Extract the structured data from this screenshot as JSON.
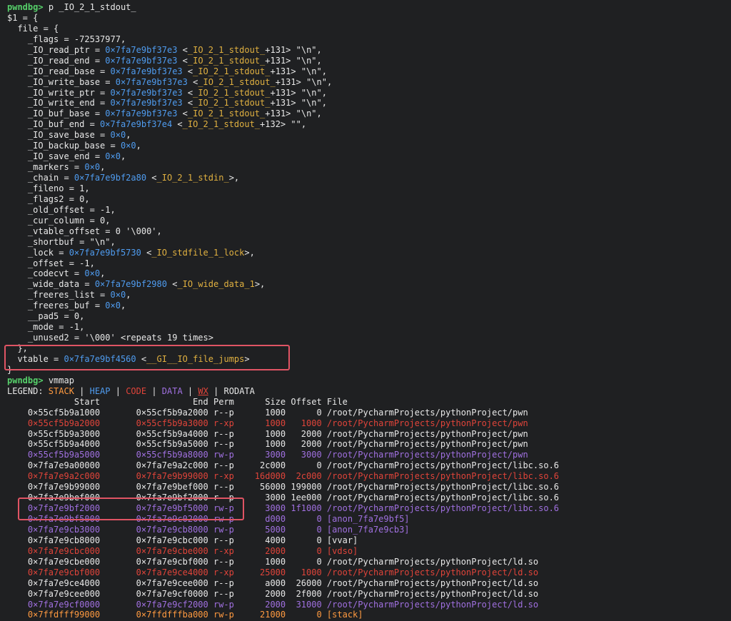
{
  "terminal": {
    "prompt": "pwndbg>",
    "cmd1": "p _IO_2_1_stdout_",
    "var_label": "$1",
    "struct_lines": [
      [
        {
          "c": "w",
          "t": "$1 = {"
        }
      ],
      [
        {
          "c": "w",
          "t": "  file = {"
        }
      ],
      [
        {
          "c": "w",
          "t": "    _flags = -72537977,"
        }
      ],
      [
        {
          "c": "w",
          "t": "    _IO_read_ptr = "
        },
        {
          "c": "b",
          "t": "0×7fa7e9bf37e3"
        },
        {
          "c": "w",
          "t": " <"
        },
        {
          "c": "y",
          "t": "_IO_2_1_stdout_"
        },
        {
          "c": "w",
          "t": "+131> \"\\n\","
        }
      ],
      [
        {
          "c": "w",
          "t": "    _IO_read_end = "
        },
        {
          "c": "b",
          "t": "0×7fa7e9bf37e3"
        },
        {
          "c": "w",
          "t": " <"
        },
        {
          "c": "y",
          "t": "_IO_2_1_stdout_"
        },
        {
          "c": "w",
          "t": "+131> \"\\n\","
        }
      ],
      [
        {
          "c": "w",
          "t": "    _IO_read_base = "
        },
        {
          "c": "b",
          "t": "0×7fa7e9bf37e3"
        },
        {
          "c": "w",
          "t": " <"
        },
        {
          "c": "y",
          "t": "_IO_2_1_stdout_"
        },
        {
          "c": "w",
          "t": "+131> \"\\n\","
        }
      ],
      [
        {
          "c": "w",
          "t": "    _IO_write_base = "
        },
        {
          "c": "b",
          "t": "0×7fa7e9bf37e3"
        },
        {
          "c": "w",
          "t": " <"
        },
        {
          "c": "y",
          "t": "_IO_2_1_stdout_"
        },
        {
          "c": "w",
          "t": "+131> \"\\n\","
        }
      ],
      [
        {
          "c": "w",
          "t": "    _IO_write_ptr = "
        },
        {
          "c": "b",
          "t": "0×7fa7e9bf37e3"
        },
        {
          "c": "w",
          "t": " <"
        },
        {
          "c": "y",
          "t": "_IO_2_1_stdout_"
        },
        {
          "c": "w",
          "t": "+131> \"\\n\","
        }
      ],
      [
        {
          "c": "w",
          "t": "    _IO_write_end = "
        },
        {
          "c": "b",
          "t": "0×7fa7e9bf37e3"
        },
        {
          "c": "w",
          "t": " <"
        },
        {
          "c": "y",
          "t": "_IO_2_1_stdout_"
        },
        {
          "c": "w",
          "t": "+131> \"\\n\","
        }
      ],
      [
        {
          "c": "w",
          "t": "    _IO_buf_base = "
        },
        {
          "c": "b",
          "t": "0×7fa7e9bf37e3"
        },
        {
          "c": "w",
          "t": " <"
        },
        {
          "c": "y",
          "t": "_IO_2_1_stdout_"
        },
        {
          "c": "w",
          "t": "+131> \"\\n\","
        }
      ],
      [
        {
          "c": "w",
          "t": "    _IO_buf_end = "
        },
        {
          "c": "b",
          "t": "0×7fa7e9bf37e4"
        },
        {
          "c": "w",
          "t": " <"
        },
        {
          "c": "y",
          "t": "_IO_2_1_stdout_"
        },
        {
          "c": "w",
          "t": "+132> \"\","
        }
      ],
      [
        {
          "c": "w",
          "t": "    _IO_save_base = "
        },
        {
          "c": "b",
          "t": "0×0"
        },
        {
          "c": "w",
          "t": ","
        }
      ],
      [
        {
          "c": "w",
          "t": "    _IO_backup_base = "
        },
        {
          "c": "b",
          "t": "0×0"
        },
        {
          "c": "w",
          "t": ","
        }
      ],
      [
        {
          "c": "w",
          "t": "    _IO_save_end = "
        },
        {
          "c": "b",
          "t": "0×0"
        },
        {
          "c": "w",
          "t": ","
        }
      ],
      [
        {
          "c": "w",
          "t": "    _markers = "
        },
        {
          "c": "b",
          "t": "0×0"
        },
        {
          "c": "w",
          "t": ","
        }
      ],
      [
        {
          "c": "w",
          "t": "    _chain = "
        },
        {
          "c": "b",
          "t": "0×7fa7e9bf2a80"
        },
        {
          "c": "w",
          "t": " <"
        },
        {
          "c": "y",
          "t": "_IO_2_1_stdin_"
        },
        {
          "c": "w",
          "t": ">,"
        }
      ],
      [
        {
          "c": "w",
          "t": "    _fileno = 1,"
        }
      ],
      [
        {
          "c": "w",
          "t": "    _flags2 = 0,"
        }
      ],
      [
        {
          "c": "w",
          "t": "    _old_offset = -1,"
        }
      ],
      [
        {
          "c": "w",
          "t": "    _cur_column = 0,"
        }
      ],
      [
        {
          "c": "w",
          "t": "    _vtable_offset = 0 '\\000',"
        }
      ],
      [
        {
          "c": "w",
          "t": "    _shortbuf = \"\\n\","
        }
      ],
      [
        {
          "c": "w",
          "t": "    _lock = "
        },
        {
          "c": "b",
          "t": "0×7fa7e9bf5730"
        },
        {
          "c": "w",
          "t": " <"
        },
        {
          "c": "y",
          "t": "_IO_stdfile_1_lock"
        },
        {
          "c": "w",
          "t": ">,"
        }
      ],
      [
        {
          "c": "w",
          "t": "    _offset = -1,"
        }
      ],
      [
        {
          "c": "w",
          "t": "    _codecvt = "
        },
        {
          "c": "b",
          "t": "0×0"
        },
        {
          "c": "w",
          "t": ","
        }
      ],
      [
        {
          "c": "w",
          "t": "    _wide_data = "
        },
        {
          "c": "b",
          "t": "0×7fa7e9bf2980"
        },
        {
          "c": "w",
          "t": " <"
        },
        {
          "c": "y",
          "t": "_IO_wide_data_1"
        },
        {
          "c": "w",
          "t": ">,"
        }
      ],
      [
        {
          "c": "w",
          "t": "    _freeres_list = "
        },
        {
          "c": "b",
          "t": "0×0"
        },
        {
          "c": "w",
          "t": ","
        }
      ],
      [
        {
          "c": "w",
          "t": "    _freeres_buf = "
        },
        {
          "c": "b",
          "t": "0×0"
        },
        {
          "c": "w",
          "t": ","
        }
      ],
      [
        {
          "c": "w",
          "t": "    __pad5 = 0,"
        }
      ],
      [
        {
          "c": "w",
          "t": "    _mode = -1,"
        }
      ],
      [
        {
          "c": "w",
          "t": "    _unused2 = '\\000' <repeats 19 times>"
        }
      ],
      [
        {
          "c": "w",
          "t": "  },"
        }
      ],
      [
        {
          "c": "w",
          "t": "  vtable = "
        },
        {
          "c": "b",
          "t": "0×7fa7e9bf4560"
        },
        {
          "c": "w",
          "t": " <"
        },
        {
          "c": "y",
          "t": "__GI__IO_file_jumps"
        },
        {
          "c": "w",
          "t": ">"
        }
      ],
      [
        {
          "c": "w",
          "t": "}"
        }
      ]
    ],
    "cmd2": "vmmap",
    "legend": {
      "label": "LEGEND:",
      "items": [
        {
          "text": "STACK",
          "color": "#ff9a40",
          "u": false
        },
        {
          "text": "HEAP",
          "color": "#4f9cf0",
          "u": false
        },
        {
          "text": "CODE",
          "color": "#e0443a",
          "u": false
        },
        {
          "text": "DATA",
          "color": "#a070e0",
          "u": false
        },
        {
          "text": "WX",
          "color": "#e0443a",
          "u": true
        },
        {
          "text": "RODATA",
          "color": "#e8e8e8",
          "u": false
        }
      ]
    },
    "vmmap_header": [
      "Start",
      "End",
      "Perm",
      "Size",
      "Offset",
      "File"
    ],
    "vmmap_rows": [
      {
        "c": "w",
        "start": "0×55cf5b9a1000",
        "end": "0×55cf5b9a2000",
        "perm": "r--p",
        "size": "1000",
        "offset": "0",
        "file": "/root/PycharmProjects/pythonProject/pwn"
      },
      {
        "c": "r",
        "start": "0×55cf5b9a2000",
        "end": "0×55cf5b9a3000",
        "perm": "r-xp",
        "size": "1000",
        "offset": "1000",
        "file": "/root/PycharmProjects/pythonProject/pwn"
      },
      {
        "c": "w",
        "start": "0×55cf5b9a3000",
        "end": "0×55cf5b9a4000",
        "perm": "r--p",
        "size": "1000",
        "offset": "2000",
        "file": "/root/PycharmProjects/pythonProject/pwn"
      },
      {
        "c": "w",
        "start": "0×55cf5b9a4000",
        "end": "0×55cf5b9a5000",
        "perm": "r--p",
        "size": "1000",
        "offset": "2000",
        "file": "/root/PycharmProjects/pythonProject/pwn"
      },
      {
        "c": "p",
        "start": "0×55cf5b9a5000",
        "end": "0×55cf5b9a8000",
        "perm": "rw-p",
        "size": "3000",
        "offset": "3000",
        "file": "/root/PycharmProjects/pythonProject/pwn"
      },
      {
        "c": "w",
        "start": "0×7fa7e9a00000",
        "end": "0×7fa7e9a2c000",
        "perm": "r--p",
        "size": "2c000",
        "offset": "0",
        "file": "/root/PycharmProjects/pythonProject/libc.so.6"
      },
      {
        "c": "r",
        "start": "0×7fa7e9a2c000",
        "end": "0×7fa7e9b99000",
        "perm": "r-xp",
        "size": "16d000",
        "offset": "2c000",
        "file": "/root/PycharmProjects/pythonProject/libc.so.6"
      },
      {
        "c": "w",
        "start": "0×7fa7e9b99000",
        "end": "0×7fa7e9bef000",
        "perm": "r--p",
        "size": "56000",
        "offset": "199000",
        "file": "/root/PycharmProjects/pythonProject/libc.so.6"
      },
      {
        "c": "w",
        "start": "0×7fa7e9bef000",
        "end": "0×7fa7e9bf2000",
        "perm": "r--p",
        "size": "3000",
        "offset": "1ee000",
        "file": "/root/PycharmProjects/pythonProject/libc.so.6"
      },
      {
        "c": "p",
        "start": "0×7fa7e9bf2000",
        "end": "0×7fa7e9bf5000",
        "perm": "rw-p",
        "size": "3000",
        "offset": "1f1000",
        "file": "/root/PycharmProjects/pythonProject/libc.so.6"
      },
      {
        "c": "p",
        "start": "0×7fa7e9bf5000",
        "end": "0×7fa7e9c02000",
        "perm": "rw-p",
        "size": "d000",
        "offset": "0",
        "file": "[anon_7fa7e9bf5]"
      },
      {
        "c": "p",
        "start": "0×7fa7e9cb3000",
        "end": "0×7fa7e9cb8000",
        "perm": "rw-p",
        "size": "5000",
        "offset": "0",
        "file": "[anon_7fa7e9cb3]"
      },
      {
        "c": "w",
        "start": "0×7fa7e9cb8000",
        "end": "0×7fa7e9cbc000",
        "perm": "r--p",
        "size": "4000",
        "offset": "0",
        "file": "[vvar]"
      },
      {
        "c": "r",
        "start": "0×7fa7e9cbc000",
        "end": "0×7fa7e9cbe000",
        "perm": "r-xp",
        "size": "2000",
        "offset": "0",
        "file": "[vdso]"
      },
      {
        "c": "w",
        "start": "0×7fa7e9cbe000",
        "end": "0×7fa7e9cbf000",
        "perm": "r--p",
        "size": "1000",
        "offset": "0",
        "file": "/root/PycharmProjects/pythonProject/ld.so"
      },
      {
        "c": "r",
        "start": "0×7fa7e9cbf000",
        "end": "0×7fa7e9ce4000",
        "perm": "r-xp",
        "size": "25000",
        "offset": "1000",
        "file": "/root/PycharmProjects/pythonProject/ld.so"
      },
      {
        "c": "w",
        "start": "0×7fa7e9ce4000",
        "end": "0×7fa7e9cee000",
        "perm": "r--p",
        "size": "a000",
        "offset": "26000",
        "file": "/root/PycharmProjects/pythonProject/ld.so"
      },
      {
        "c": "w",
        "start": "0×7fa7e9cee000",
        "end": "0×7fa7e9cf0000",
        "perm": "r--p",
        "size": "2000",
        "offset": "2f000",
        "file": "/root/PycharmProjects/pythonProject/ld.so"
      },
      {
        "c": "p",
        "start": "0×7fa7e9cf0000",
        "end": "0×7fa7e9cf2000",
        "perm": "rw-p",
        "size": "2000",
        "offset": "31000",
        "file": "/root/PycharmProjects/pythonProject/ld.so"
      },
      {
        "c": "o",
        "start": "0×7ffdfff99000",
        "end": "0×7ffdfffba000",
        "perm": "rw-p",
        "size": "21000",
        "offset": "0",
        "file": "[stack]"
      }
    ],
    "highlight_color": "#e05464"
  }
}
